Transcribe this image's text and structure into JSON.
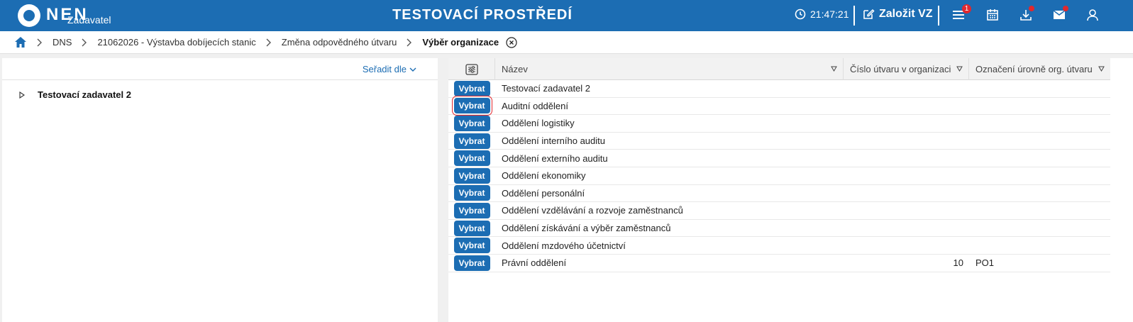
{
  "header": {
    "logo_text": "NEN",
    "logo_sub": "Zadavatel",
    "env_title": "TESTOVACÍ PROSTŘEDÍ",
    "clock": "21:47:21",
    "create_label": "Založit VZ",
    "menu_badge": "1",
    "icons": [
      "clock-icon",
      "edit-icon",
      "menu-icon",
      "calendar-icon",
      "download-icon",
      "mail-icon",
      "user-icon"
    ],
    "accent_color": "#1c6db3",
    "badge_color": "#e0282e"
  },
  "breadcrumb": {
    "items": [
      "DNS",
      "21062026 - Výstavba dobíjecích stanic",
      "Změna odpovědného útvaru"
    ],
    "current": "Výběr organizace"
  },
  "left_panel": {
    "sort_label": "Seřadit dle",
    "tree": [
      {
        "label": "Testovací zadavatel 2"
      }
    ]
  },
  "table": {
    "columns": [
      "Název",
      "Číslo útvaru v organizaci",
      "Označení úrovně org. útvaru"
    ],
    "select_label": "Vybrat",
    "rows": [
      {
        "name": "Testovací zadavatel 2",
        "number": "",
        "level": ""
      },
      {
        "name": "Auditní oddělení",
        "number": "",
        "level": ""
      },
      {
        "name": "Oddělení logistiky",
        "number": "",
        "level": ""
      },
      {
        "name": "Oddělení interního auditu",
        "number": "",
        "level": ""
      },
      {
        "name": "Oddělení externího auditu",
        "number": "",
        "level": ""
      },
      {
        "name": "Oddělení ekonomiky",
        "number": "",
        "level": ""
      },
      {
        "name": "Oddělení personální",
        "number": "",
        "level": ""
      },
      {
        "name": "Oddělení vzdělávání a rozvoje zaměstnanců",
        "number": "",
        "level": ""
      },
      {
        "name": "Oddělení získávání a výběr zaměstnanců",
        "number": "",
        "level": ""
      },
      {
        "name": "Oddělení mzdového účetnictví",
        "number": "",
        "level": ""
      },
      {
        "name": "Právní oddělení",
        "number": "10",
        "level": "PO1"
      }
    ]
  }
}
